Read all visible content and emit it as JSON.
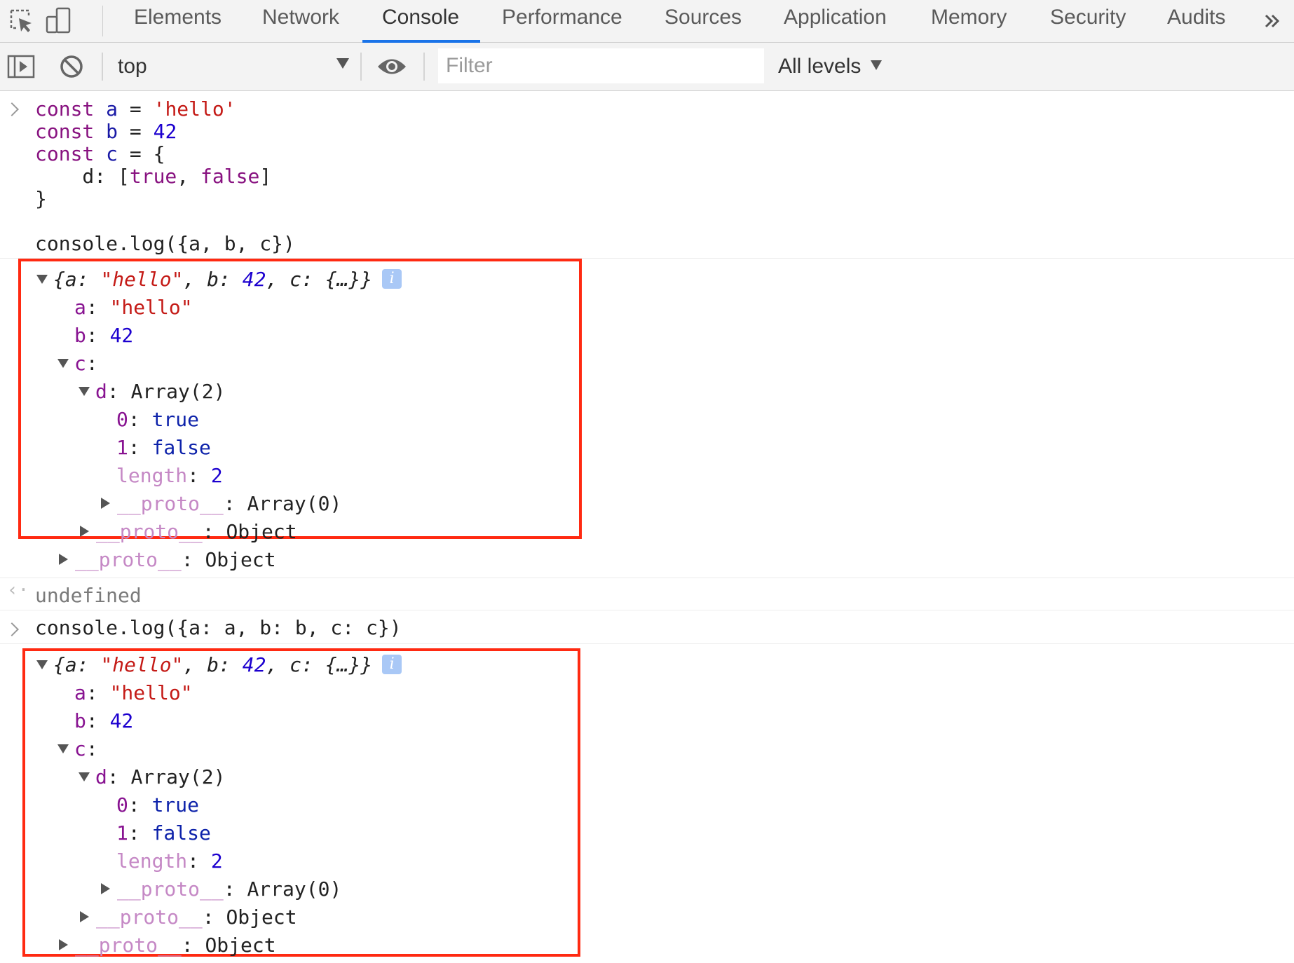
{
  "tabs": [
    "Elements",
    "Network",
    "Console",
    "Performance",
    "Sources",
    "Application",
    "Memory",
    "Security",
    "Audits"
  ],
  "active_tab": "Console",
  "toolbar": {
    "context": "top",
    "filter_placeholder": "Filter",
    "levels": "All levels"
  },
  "console": {
    "input1": {
      "l1": {
        "kw": "const",
        "name": "a",
        "op": " = ",
        "val": "'hello'"
      },
      "l2": {
        "kw": "const",
        "name": "b",
        "op": " = ",
        "val": "42"
      },
      "l3": {
        "kw": "const",
        "name": "c",
        "op": " = {"
      },
      "l4": {
        "prefix": "    d: [",
        "v1": "true",
        "sep": ", ",
        "v2": "false",
        "suffix": "]"
      },
      "l5": "}",
      "l6": "console.log({a, b, c})"
    },
    "object1": {
      "summary": {
        "open": "{a: ",
        "a": "\"hello\"",
        "s1": ", b: ",
        "b": "42",
        "s2": ", c: ",
        "c": "{…}}"
      },
      "a": {
        "key": "a",
        "val": "\"hello\""
      },
      "b": {
        "key": "b",
        "val": "42"
      },
      "c": {
        "key": "c"
      },
      "d": {
        "key": "d",
        "val": "Array(2)"
      },
      "d0": {
        "key": "0",
        "val": "true"
      },
      "d1": {
        "key": "1",
        "val": "false"
      },
      "len": {
        "key": "length",
        "val": "2"
      },
      "arr_proto": {
        "key": "__proto__",
        "val": "Array(0)"
      },
      "c_proto": {
        "key": "__proto__",
        "val": "Object"
      },
      "proto": {
        "key": "__proto__",
        "val": "Object"
      }
    },
    "result1": "undefined",
    "input2": "console.log({a: a, b: b, c: c})",
    "object2": {
      "summary": {
        "open": "{a: ",
        "a": "\"hello\"",
        "s1": ", b: ",
        "b": "42",
        "s2": ", c: ",
        "c": "{…}}"
      },
      "a": {
        "key": "a",
        "val": "\"hello\""
      },
      "b": {
        "key": "b",
        "val": "42"
      },
      "c": {
        "key": "c"
      },
      "d": {
        "key": "d",
        "val": "Array(2)"
      },
      "d0": {
        "key": "0",
        "val": "true"
      },
      "d1": {
        "key": "1",
        "val": "false"
      },
      "len": {
        "key": "length",
        "val": "2"
      },
      "arr_proto": {
        "key": "__proto__",
        "val": "Array(0)"
      },
      "c_proto": {
        "key": "__proto__",
        "val": "Object"
      },
      "proto": {
        "key": "__proto__",
        "val": "Object"
      }
    }
  },
  "icons": [
    "inspect-element-icon",
    "device-toolbar-icon",
    "more-tabs-icon",
    "sidebar-toggle-icon",
    "clear-console-icon",
    "live-expression-eye-icon",
    "info-icon"
  ],
  "colors": {
    "highlight": "#ff2a12",
    "active_tab_underline": "#1a73e8"
  }
}
